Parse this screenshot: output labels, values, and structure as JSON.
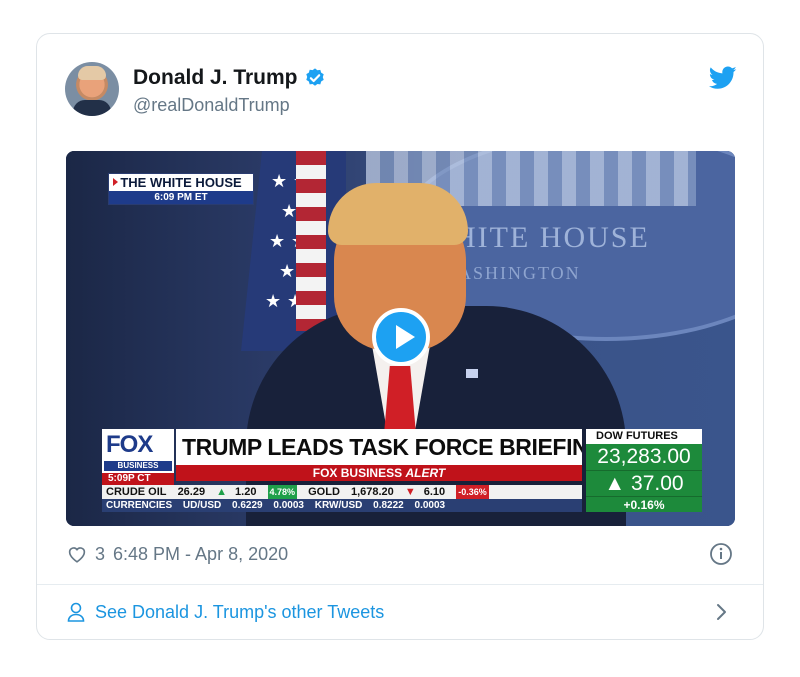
{
  "tweet": {
    "author_name": "Donald J. Trump",
    "handle": "@realDonaldTrump",
    "likes": "3",
    "timestamp": "6:48 PM - Apr 8, 2020",
    "footer_link": "See Donald J. Trump's other Tweets"
  },
  "video": {
    "location_badge": "THE WHITE HOUSE",
    "location_time": "6:09 PM ET",
    "backdrop_title": "HITE HOUSE",
    "backdrop_sub": "ASHINGTON",
    "network_logo": "FOX",
    "network_sub": "BUSINESS",
    "network_time": "5:09P CT",
    "headline": "TRUMP LEADS TASK FORCE BRIEFING",
    "alert_prefix": "FOX BUSINESS",
    "alert_word": "ALERT",
    "ticker_row1": {
      "crude_label": "CRUDE OIL",
      "crude_value": "26.29",
      "crude_change": "1.20",
      "crude_pct": "4.78%",
      "gold_label": "GOLD",
      "gold_value": "1,678.20",
      "gold_change": "6.10",
      "gold_pct": "-0.36%"
    },
    "ticker_row2": {
      "label": "CURRENCIES",
      "pair1": "UD/USD",
      "pair1_value": "0.6229",
      "pair1_change": "0.0003",
      "pair2": "KRW/USD",
      "pair2_value": "0.8222",
      "pair2_change": "0.0003"
    },
    "dow": {
      "label": "DOW FUTURES",
      "value": "23,283.00",
      "change": "37.00",
      "pct": "+0.16%"
    }
  },
  "colors": {
    "twitter_blue": "#1da1f2",
    "link_blue": "#1b95e0",
    "fox_red": "#c0121a",
    "market_green": "#1d8a3b"
  }
}
